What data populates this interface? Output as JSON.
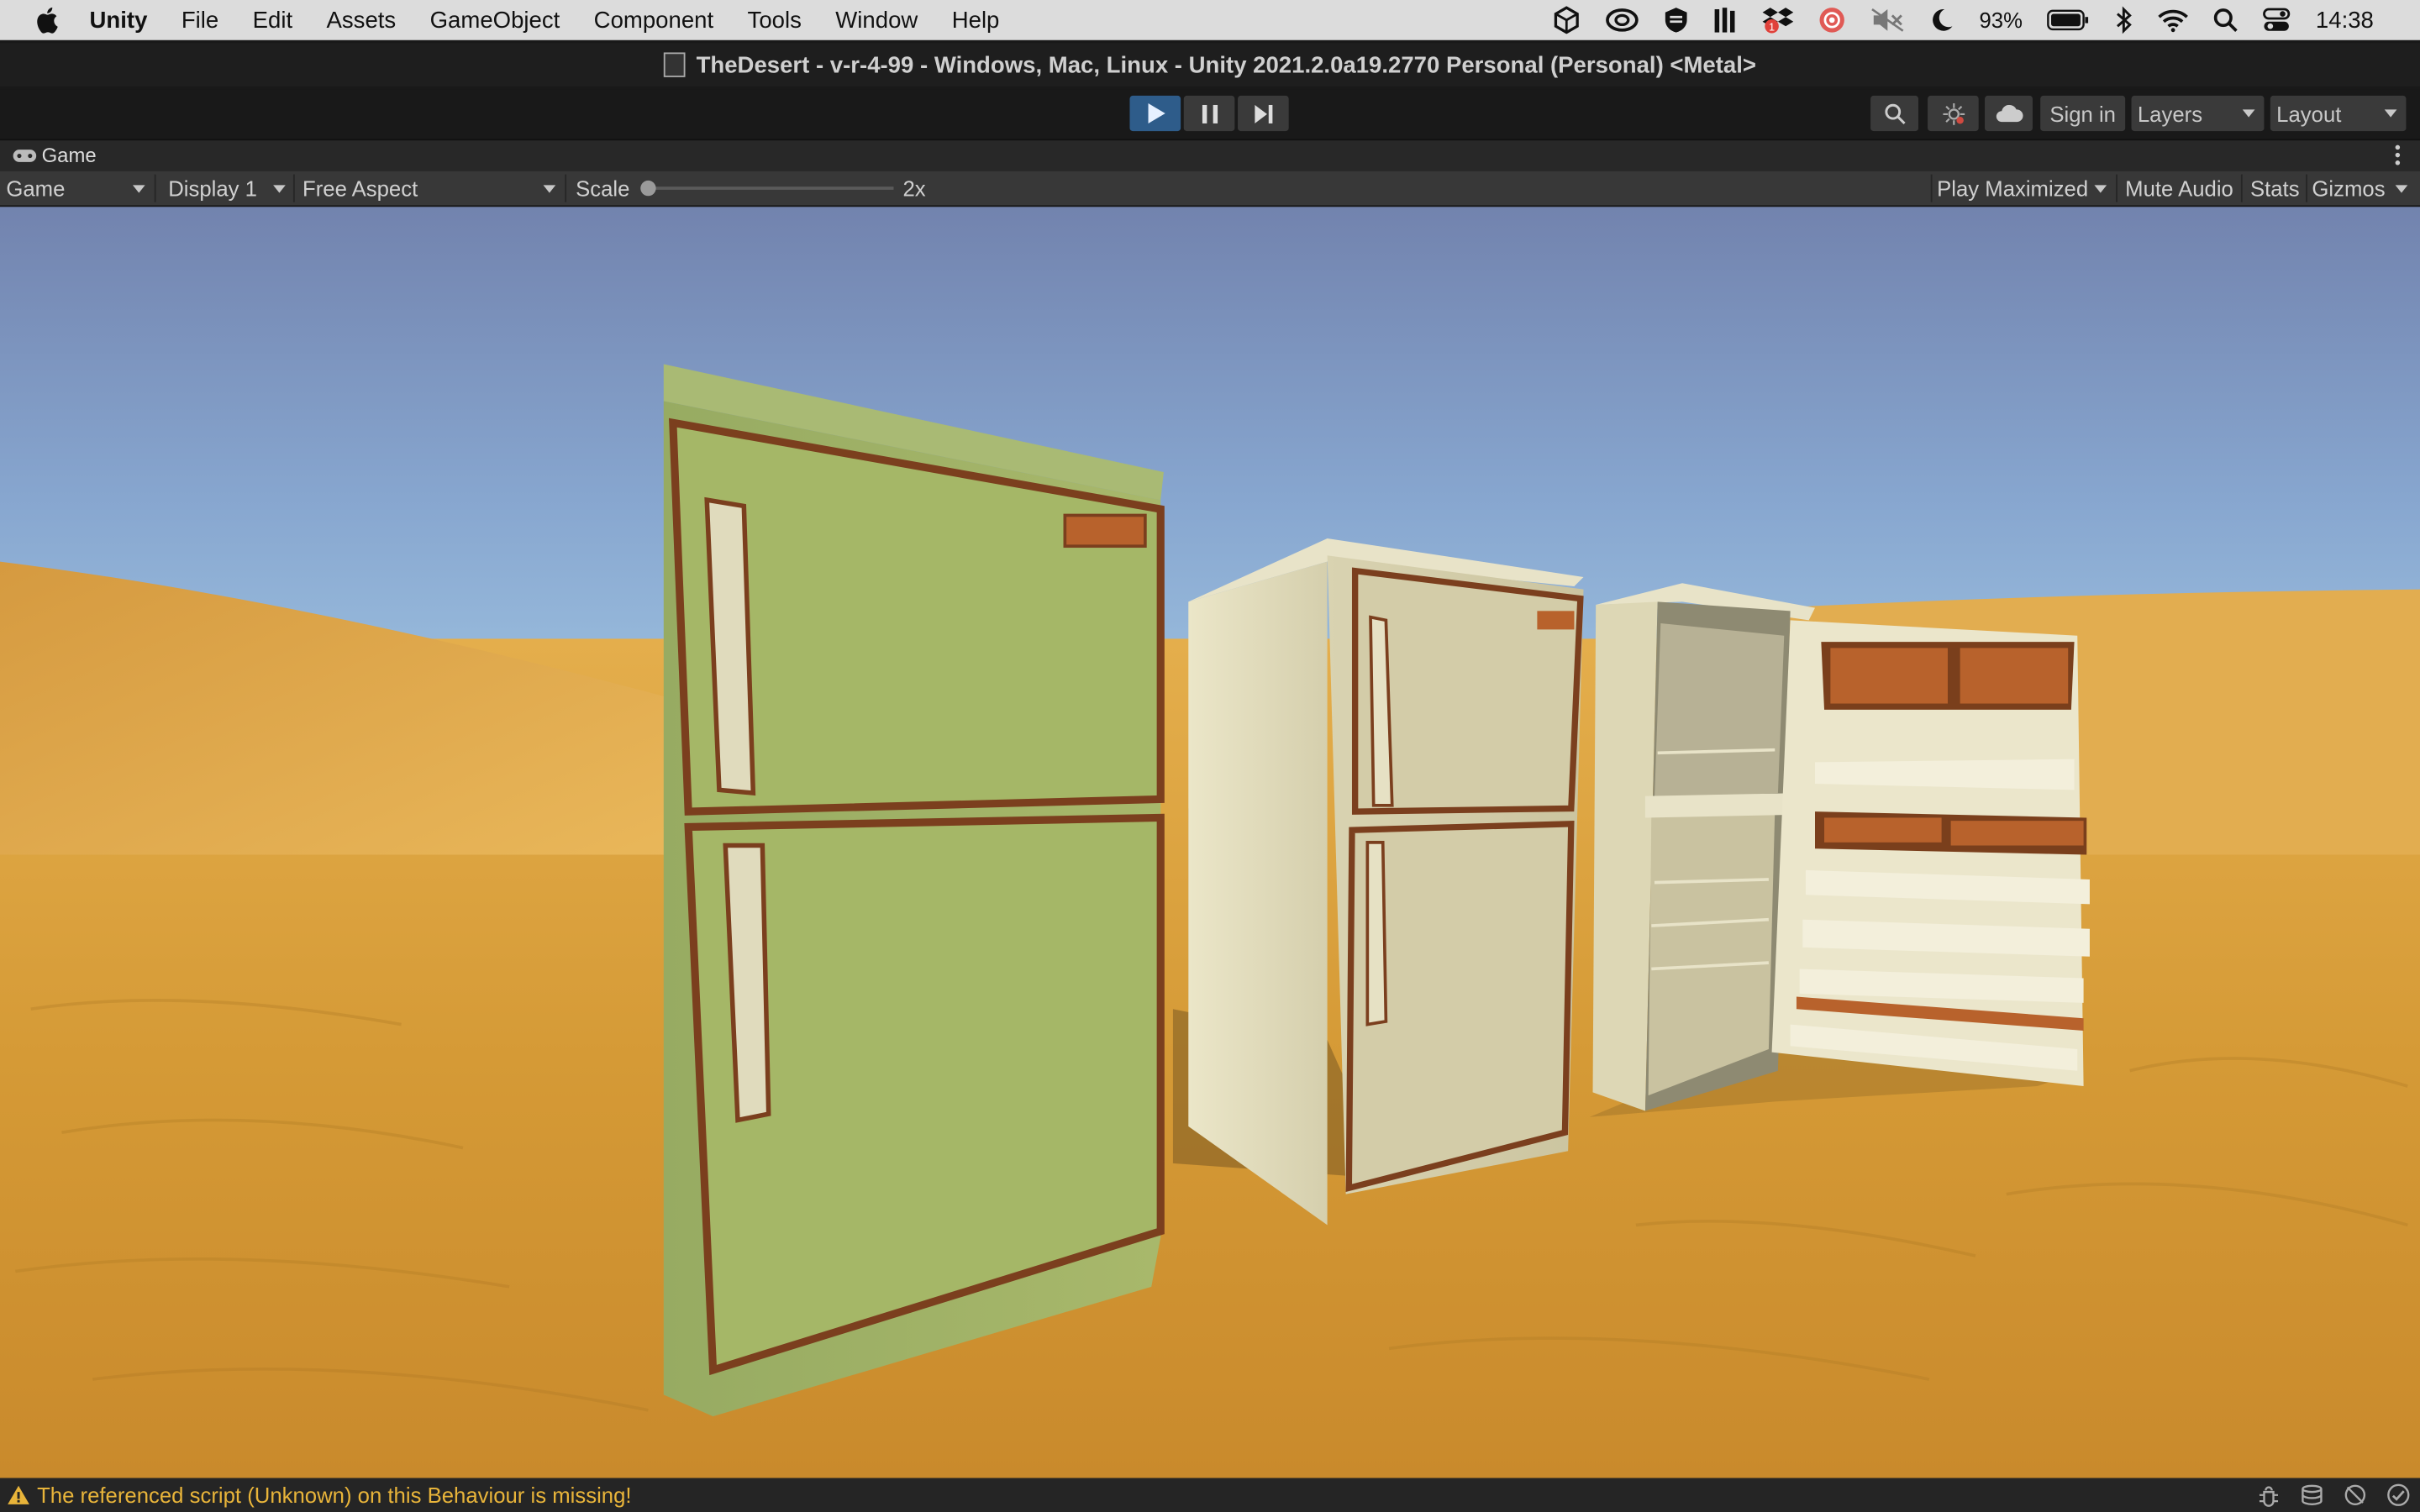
{
  "menubar": {
    "app_name": "Unity",
    "items": [
      "File",
      "Edit",
      "Assets",
      "GameObject",
      "Component",
      "Tools",
      "Window",
      "Help"
    ],
    "battery": "93%",
    "clock": "14:38"
  },
  "window": {
    "title": "TheDesert - v-r-4-99 - Windows, Mac, Linux - Unity 2021.2.0a19.2770 Personal (Personal) <Metal>"
  },
  "toolbar": {
    "sign_in": "Sign in",
    "layers": "Layers",
    "layout": "Layout"
  },
  "game_panel": {
    "tab_label": "Game",
    "view_select": "Game",
    "display_select": "Display 1",
    "aspect_select": "Free Aspect",
    "scale_label": "Scale",
    "scale_value": "2x",
    "scale_fraction": 0.0,
    "play_maximized": "Play Maximized",
    "mute_audio": "Mute Audio",
    "stats": "Stats",
    "gizmos": "Gizmos"
  },
  "status": {
    "message": "The referenced script (Unknown) on this Behaviour is missing!"
  },
  "colors": {
    "accent_blue": "#2e5c8a",
    "warning": "#e8b43a",
    "sky_top": "#7d8db8",
    "sand": "#d9a03a"
  }
}
